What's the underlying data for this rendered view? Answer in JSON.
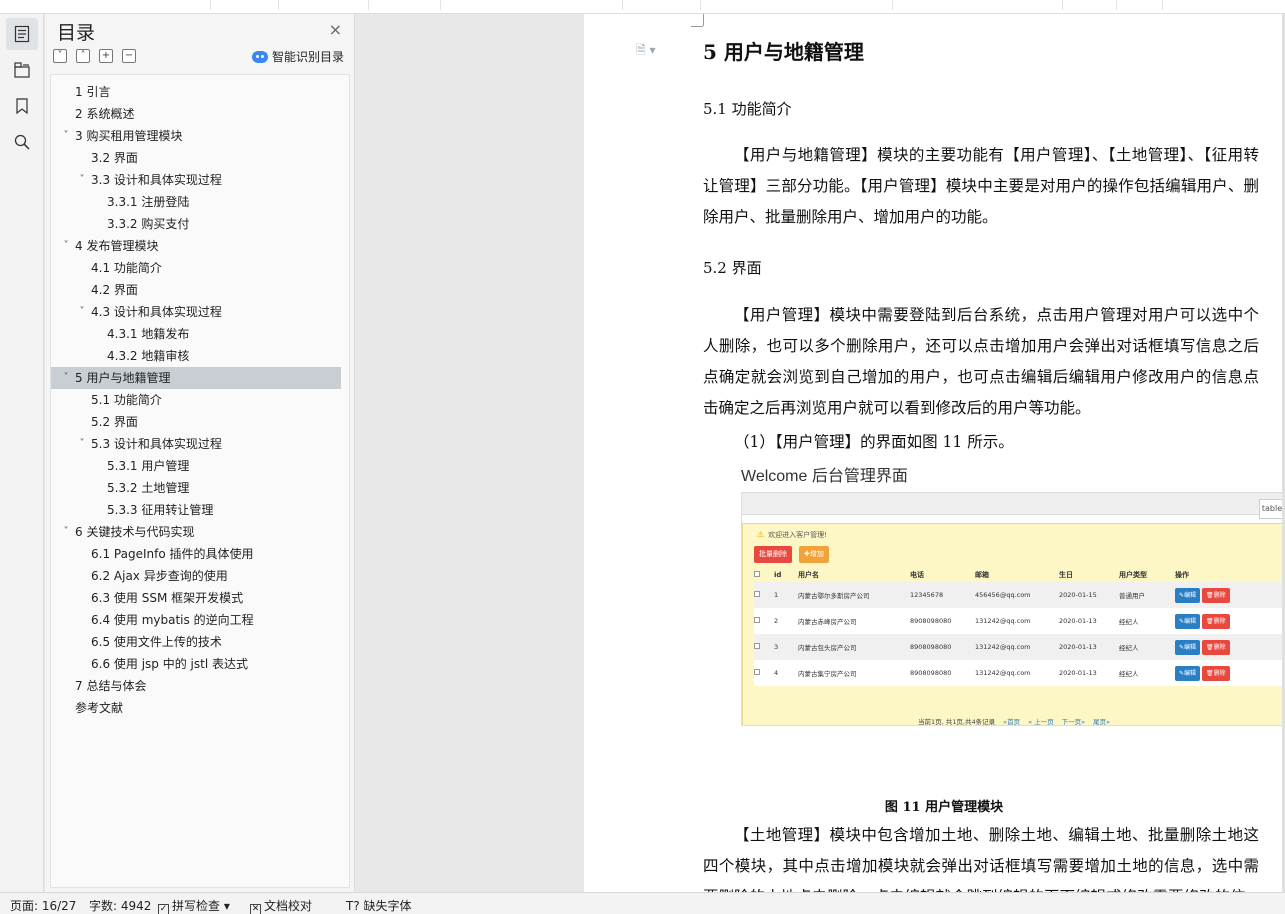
{
  "toc": {
    "title": "目录",
    "close_icon": "×",
    "smart_label": "智能识别目录",
    "items": [
      {
        "label": "1  引言",
        "level": 0,
        "has_children": false,
        "selected": false
      },
      {
        "label": "2  系统概述",
        "level": 0,
        "has_children": false,
        "selected": false
      },
      {
        "label": "3  购买租用管理模块",
        "level": 0,
        "has_children": true,
        "selected": false
      },
      {
        "label": "3.2  界面",
        "level": 1,
        "has_children": false,
        "selected": false
      },
      {
        "label": "3.3  设计和具体实现过程",
        "level": 1,
        "has_children": true,
        "selected": false
      },
      {
        "label": "3.3.1  注册登陆",
        "level": 2,
        "has_children": false,
        "selected": false
      },
      {
        "label": "3.3.2 购买支付",
        "level": 2,
        "has_children": false,
        "selected": false
      },
      {
        "label": "4  发布管理模块",
        "level": 0,
        "has_children": true,
        "selected": false
      },
      {
        "label": "4.1  功能简介",
        "level": 1,
        "has_children": false,
        "selected": false
      },
      {
        "label": "4.2 界面",
        "level": 1,
        "has_children": false,
        "selected": false
      },
      {
        "label": "4.3 设计和具体实现过程",
        "level": 1,
        "has_children": true,
        "selected": false
      },
      {
        "label": "4.3.1 地籍发布",
        "level": 2,
        "has_children": false,
        "selected": false
      },
      {
        "label": "4.3.2 地籍审核",
        "level": 2,
        "has_children": false,
        "selected": false
      },
      {
        "label": "5 用户与地籍管理",
        "level": 0,
        "has_children": true,
        "selected": true
      },
      {
        "label": "5.1 功能简介",
        "level": 1,
        "has_children": false,
        "selected": false
      },
      {
        "label": "5.2 界面",
        "level": 1,
        "has_children": false,
        "selected": false
      },
      {
        "label": "5.3 设计和具体实现过程",
        "level": 1,
        "has_children": true,
        "selected": false
      },
      {
        "label": "5.3.1 用户管理",
        "level": 2,
        "has_children": false,
        "selected": false
      },
      {
        "label": "5.3.2 土地管理",
        "level": 2,
        "has_children": false,
        "selected": false
      },
      {
        "label": "5.3.3 征用转让管理",
        "level": 2,
        "has_children": false,
        "selected": false
      },
      {
        "label": "6 关键技术与代码实现",
        "level": 0,
        "has_children": true,
        "selected": false
      },
      {
        "label": "6.1 PageInfo 插件的具体使用",
        "level": 1,
        "has_children": false,
        "selected": false
      },
      {
        "label": "6.2 Ajax 异步查询的使用",
        "level": 1,
        "has_children": false,
        "selected": false
      },
      {
        "label": "6.3  使用 SSM 框架开发模式",
        "level": 1,
        "has_children": false,
        "selected": false
      },
      {
        "label": "6.4  使用 mybatis 的逆向工程",
        "level": 1,
        "has_children": false,
        "selected": false
      },
      {
        "label": "6.5  使用文件上传的技术",
        "level": 1,
        "has_children": false,
        "selected": false
      },
      {
        "label": "6.6  使用 jsp 中的 jstl 表达式",
        "level": 1,
        "has_children": false,
        "selected": false
      },
      {
        "label": "7  总结与体会",
        "level": 0,
        "has_children": false,
        "selected": false
      },
      {
        "label": "参考文献",
        "level": 0,
        "has_children": false,
        "selected": false
      }
    ]
  },
  "document": {
    "heading": "5 用户与地籍管理",
    "section_51": "5.1 功能简介",
    "para_51": "【用户与地籍管理】模块的主要功能有【用户管理】、【土地管理】、【征用转让管理】三部分功能。【用户管理】模块中主要是对用户的操作包括编辑用户、删除用户、批量删除用户、增加用户的功能。",
    "section_52": "5.2 界面",
    "para_52": "【用户管理】模块中需要登陆到后台系统，点击用户管理对用户可以选中个人删除，也可以多个删除用户，还可以点击增加用户会弹出对话框填写信息之后点确定就会浏览到自己增加的用户，也可点击编辑后编辑用户修改用户的信息点击确定之后再浏览用户就可以看到修改后的用户等功能。",
    "fig_intro": "（1）【用户管理】的界面如图 11 所示。",
    "welcome": "Welcome 后台管理界面",
    "caption": "图 11  用户管理模块",
    "para_land": "【土地管理】模块中包含增加土地、删除土地、编辑土地、批量删除土地这四个模块，其中点击增加模块就会弹出对话框填写需要增加土地的信息，选中需要删除的土地点击删除，点击编辑就会跳到编辑的页面编辑或修改需要修改的信"
  },
  "screenshot": {
    "tab": "table",
    "welcome": "欢迎进入客户管理!",
    "btn_batch_delete": "批量删除",
    "btn_add": "✚增加",
    "headers": [
      "",
      "id",
      "用户名",
      "电话",
      "邮箱",
      "生日",
      "用户类型",
      "操作"
    ],
    "rows": [
      {
        "id": "1",
        "name": "内蒙古鄂尔多斯房产公司",
        "phone": "12345678",
        "email": "456456@qq.com",
        "birthday": "2020-01-15",
        "type": "普通用户"
      },
      {
        "id": "2",
        "name": "内蒙古赤峰房产公司",
        "phone": "8908098080",
        "email": "131242@qq.com",
        "birthday": "2020-01-13",
        "type": "经纪人"
      },
      {
        "id": "3",
        "name": "内蒙古包头房产公司",
        "phone": "8908098080",
        "email": "131242@qq.com",
        "birthday": "2020-01-13",
        "type": "经纪人"
      },
      {
        "id": "4",
        "name": "内蒙古集宁房产公司",
        "phone": "8908098080",
        "email": "131242@qq.com",
        "birthday": "2020-01-13",
        "type": "经纪人"
      }
    ],
    "edit_label": "✎编辑",
    "delete_label": "🗑删除",
    "pager_text": "当前1页, 共1页,共4条记录",
    "pager_first": "«首页",
    "pager_prev": "« 上一页",
    "pager_next": "下一页»",
    "pager_last": "尾页»"
  },
  "status": {
    "page": "页面: 16/27",
    "words": "字数: 4942",
    "spell": "拼写检查",
    "proof": "文档校对",
    "missing_font": "缺失字体"
  }
}
